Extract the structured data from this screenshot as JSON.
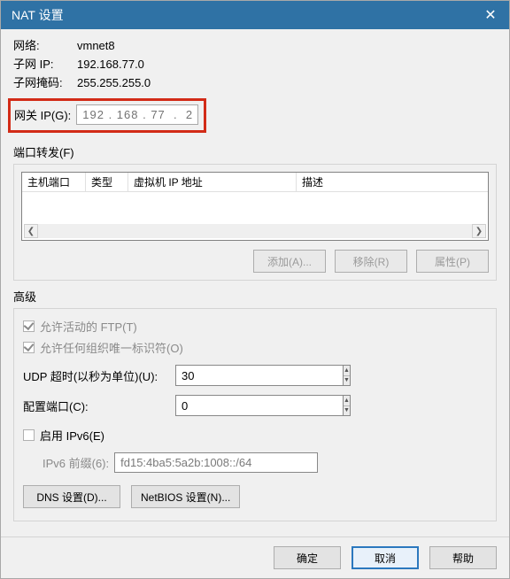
{
  "title": "NAT 设置",
  "info": {
    "network_label": "网络:",
    "network_value": "vmnet8",
    "subnet_ip_label": "子网 IP:",
    "subnet_ip_value": "192.168.77.0",
    "subnet_mask_label": "子网掩码:",
    "subnet_mask_value": "255.255.255.0",
    "gateway_label": "网关 IP(G):",
    "gateway_value": "192 . 168 . 77  .  2"
  },
  "port_forward": {
    "group_label": "端口转发(F)",
    "columns": {
      "host_port": "主机端口",
      "type": "类型",
      "vm_ip": "虚拟机 IP 地址",
      "desc": "描述"
    },
    "buttons": {
      "add": "添加(A)...",
      "remove": "移除(R)",
      "props": "属性(P)"
    }
  },
  "advanced": {
    "group_label": "高级",
    "allow_ftp": "允许活动的 FTP(T)",
    "allow_oui": "允许任何组织唯一标识符(O)",
    "udp_timeout_label": "UDP 超时(以秒为单位)(U):",
    "udp_timeout_value": "30",
    "config_port_label": "配置端口(C):",
    "config_port_value": "0",
    "enable_ipv6": "启用 IPv6(E)",
    "ipv6_prefix_label": "IPv6 前缀(6):",
    "ipv6_prefix_value": "fd15:4ba5:5a2b:1008::/64",
    "dns_btn": "DNS 设置(D)...",
    "netbios_btn": "NetBIOS 设置(N)..."
  },
  "footer": {
    "ok": "确定",
    "cancel": "取消",
    "help": "帮助"
  }
}
